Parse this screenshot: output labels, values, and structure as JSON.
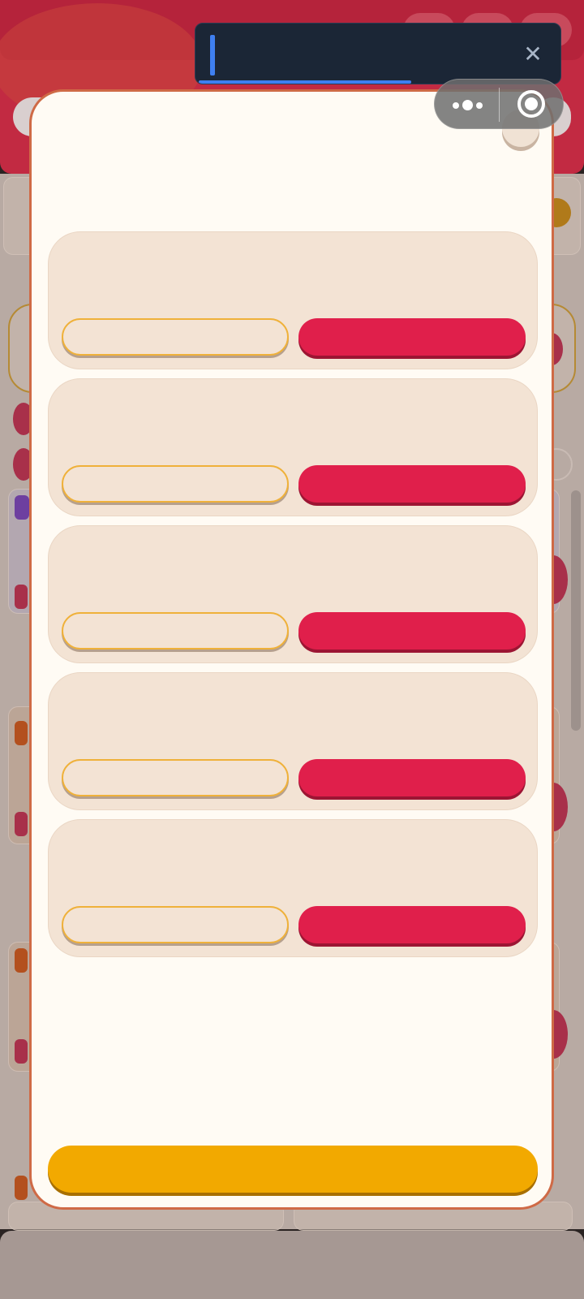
{
  "input": {
    "value": "",
    "placeholder": "",
    "clear_icon": "close-icon"
  },
  "capsule": {
    "more_icon": "more-dots-icon",
    "close_icon": "target-circle-icon"
  },
  "modal": {
    "title": "",
    "close_icon": "close-icon",
    "options": [
      {
        "label": "",
        "secondary_label": "",
        "primary_label": ""
      },
      {
        "label": "",
        "secondary_label": "",
        "primary_label": ""
      },
      {
        "label": "",
        "secondary_label": "",
        "primary_label": ""
      },
      {
        "label": "",
        "secondary_label": "",
        "primary_label": ""
      },
      {
        "label": "",
        "secondary_label": "",
        "primary_label": ""
      }
    ],
    "confirm_label": ""
  },
  "colors": {
    "header_red": "#c22a42",
    "modal_bg": "#fffbf4",
    "modal_border": "#cf6a46",
    "card_bg": "#f3e3d4",
    "primary_red": "#e01f4b",
    "outline_yellow": "#efb13a",
    "confirm_yellow": "#f2a900",
    "input_bg": "#1b2636",
    "input_accent": "#3f7ff0"
  }
}
